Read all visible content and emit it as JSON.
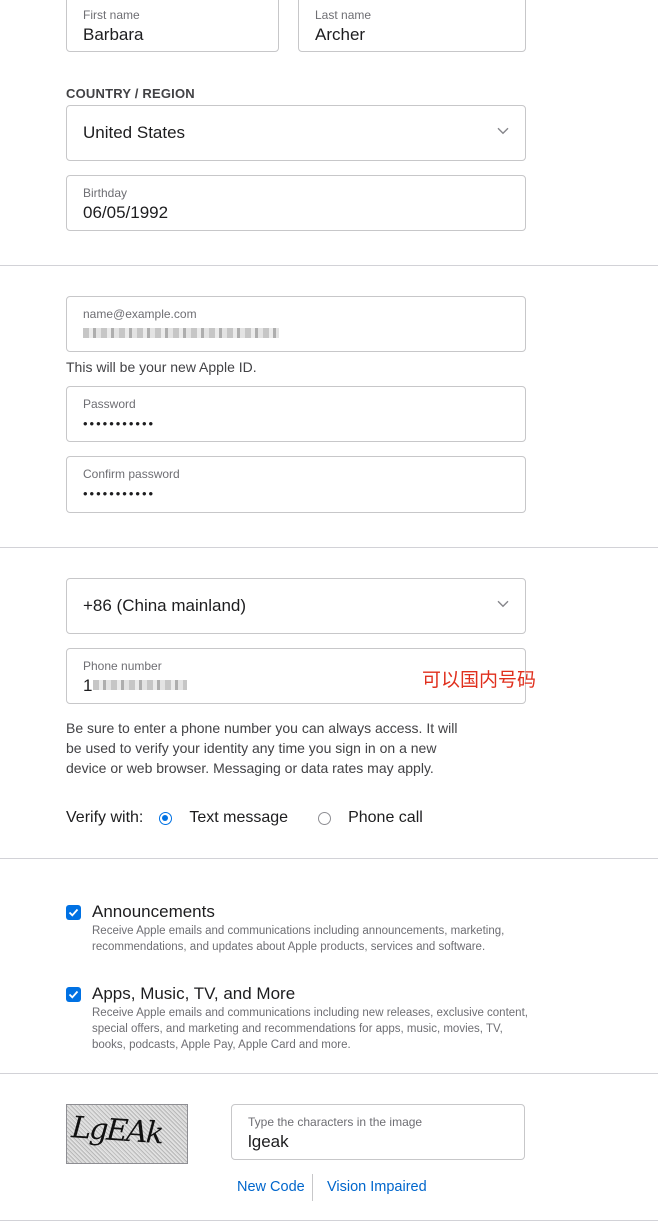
{
  "name": {
    "first_label": "First name",
    "first_value": "Barbara",
    "last_label": "Last name",
    "last_value": "Archer"
  },
  "country": {
    "section_label": "COUNTRY / REGION",
    "selected": "United States"
  },
  "birthday": {
    "label": "Birthday",
    "value": "06/05/1992"
  },
  "account": {
    "email_label": "name@example.com",
    "email_value_visible": "...skyu..p@outlook.co...",
    "email_hint": "This will be your new Apple ID.",
    "password_label": "Password",
    "password_mask": "•••••••••••",
    "confirm_label": "Confirm password",
    "confirm_mask": "•••••••••••"
  },
  "phone": {
    "country_code": "+86 (China mainland)",
    "number_label": "Phone number",
    "number_visible": "1",
    "annotation": "可以国内号码",
    "hint": "Be sure to enter a phone number you can always access. It will be used to verify your identity any time you sign in on a new device or web browser. Messaging or data rates may apply.",
    "verify_label": "Verify with:",
    "option_text": "Text message",
    "option_call": "Phone call",
    "selected": "text"
  },
  "prefs": [
    {
      "title": "Announcements",
      "checked": true,
      "desc": "Receive Apple emails and communications including announcements, marketing, recommendations, and updates about Apple products, services and software."
    },
    {
      "title": "Apps, Music, TV, and More",
      "checked": true,
      "desc": "Receive Apple emails and communications including new releases, exclusive content, special offers, and marketing and recommendations for apps, music, movies, TV, books, podcasts, Apple Pay, Apple Card and more."
    }
  ],
  "captcha": {
    "image_text": "LgEAk",
    "input_label": "Type the characters in the image",
    "input_value": "lgeak",
    "new_code": "New Code",
    "vision_impaired": "Vision Impaired"
  },
  "colors": {
    "accent": "#0071e3",
    "link": "#0066cc",
    "annotation": "#e0301e",
    "border": "#c7c7c9"
  },
  "icons": {
    "select_chevron": "chevron-down-icon",
    "checkbox": "checkmark-icon"
  }
}
